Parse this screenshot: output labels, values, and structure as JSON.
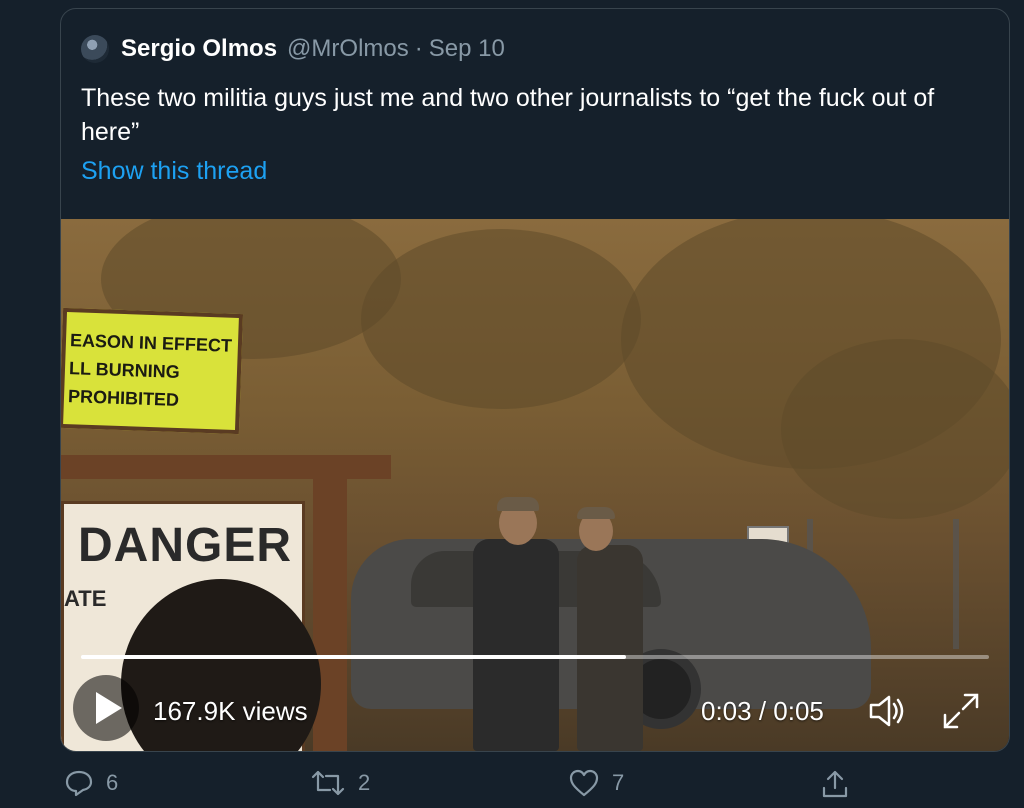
{
  "tweet": {
    "author_name": "Sergio Olmos",
    "handle": "@MrOlmos",
    "separator": "·",
    "date": "Sep 10",
    "text": "These two militia guys just me and two other journalists to “get the fuck out of here”",
    "show_thread": "Show this thread"
  },
  "video": {
    "sign_lines": [
      "EASON IN EFFECT",
      "LL BURNING",
      "PROHIBITED"
    ],
    "danger_text": "DANGER",
    "sign_sub": "ATE",
    "views": "167.9K views",
    "time": "0:03 / 0:05",
    "progress": 0.6,
    "play_icon": "play-icon",
    "volume_icon": "volume-icon",
    "expand_icon": "expand-icon"
  },
  "actions": {
    "reply_count": "6",
    "retweet_count": "2",
    "like_count": "7",
    "reply_icon": "reply-icon",
    "retweet_icon": "retweet-icon",
    "like_icon": "heart-icon",
    "share_icon": "share-icon"
  },
  "colors": {
    "background": "#15202b",
    "link": "#1da1f2",
    "muted": "#8899a6",
    "border": "#38444d"
  }
}
